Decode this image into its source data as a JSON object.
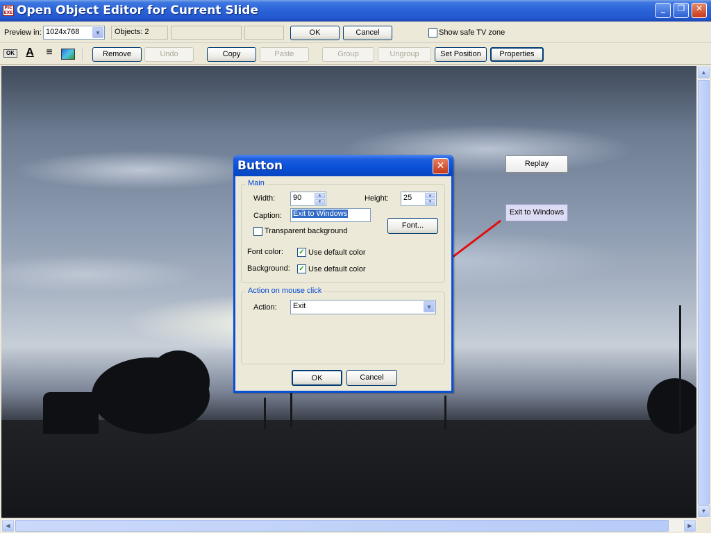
{
  "window": {
    "app_icon_text": "PIC EXE",
    "title": "Open Object Editor for Current Slide",
    "minimize": "_",
    "maximize": "❐",
    "close": "✕"
  },
  "toolbar1": {
    "preview_label": "Preview in:",
    "preview_value": "1024x768",
    "objects_text": "Objects: 2",
    "ok_label": "OK",
    "cancel_label": "Cancel",
    "safe_tv_label": "Show safe TV zone"
  },
  "toolbar2": {
    "ok_tool": "OK",
    "text_tool": "A",
    "list_tool": "≡",
    "remove": "Remove",
    "undo": "Undo",
    "copy": "Copy",
    "paste": "Paste",
    "group": "Group",
    "ungroup": "Ungroup",
    "set_position": "Set Position",
    "properties": "Properties"
  },
  "slide": {
    "replay_button": "Replay",
    "exit_button": "Exit to Windows"
  },
  "dialog": {
    "title": "Button",
    "main_group": "Main",
    "width_label": "Width:",
    "width_value": "90",
    "height_label": "Height:",
    "height_value": "25",
    "caption_label": "Caption:",
    "caption_value": "Exit to Windows",
    "transparent_label": "Transparent background",
    "font_button": "Font...",
    "font_color_label": "Font color:",
    "font_color_check": "Use default color",
    "background_label": "Background:",
    "background_check": "Use default color",
    "action_group": "Action on mouse click",
    "action_label": "Action:",
    "action_value": "Exit",
    "ok": "OK",
    "cancel": "Cancel"
  },
  "colors": {
    "titlebar": "#2458cf",
    "dialog_border": "#0a50d6",
    "annotation_line": "#e01010",
    "group_title": "#0046d5"
  }
}
